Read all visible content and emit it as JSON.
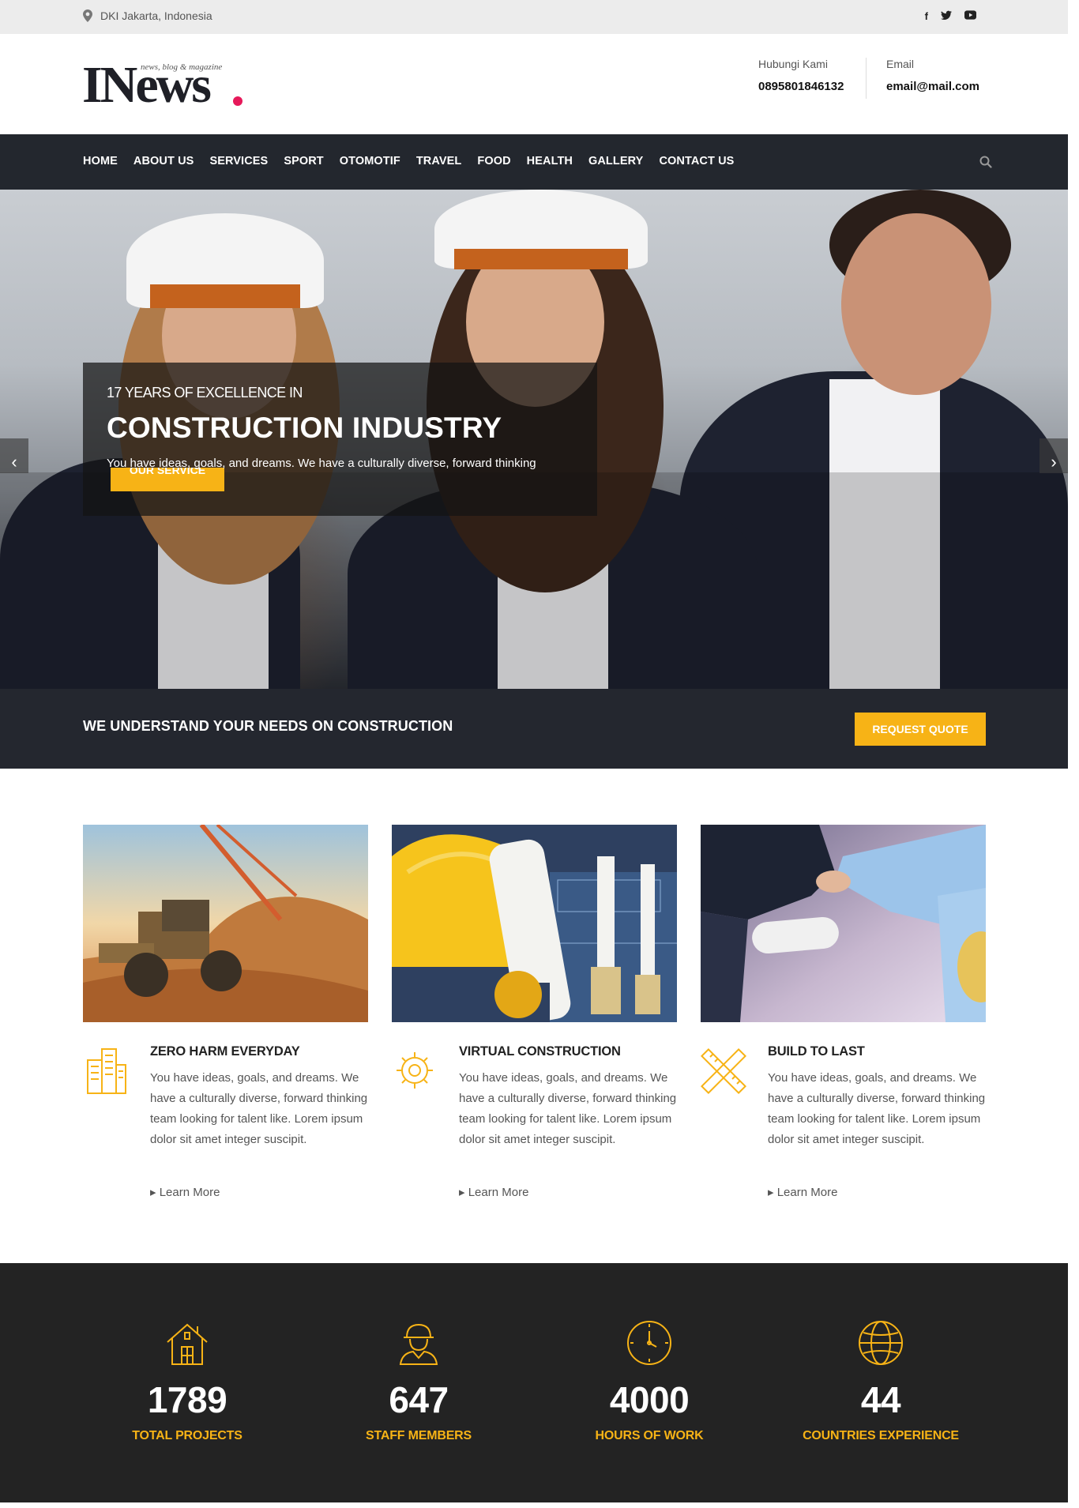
{
  "topbar": {
    "location": "DKI Jakarta, Indonesia",
    "social": [
      "f",
      "t",
      "y"
    ]
  },
  "header": {
    "logo_text": "INews",
    "logo_tagline": "news, blog & magazine",
    "contact_label": "Hubungi Kami",
    "contact_value": "0895801846132",
    "email_label": "Email",
    "email_value": "email@mail.com"
  },
  "nav": {
    "items": [
      "HOME",
      "ABOUT US",
      "SERVICES",
      "SPORT",
      "OTOMOTIF",
      "TRAVEL",
      "FOOD",
      "HEALTH",
      "GALLERY",
      "CONTACT US"
    ]
  },
  "hero": {
    "pretitle": "17 YEARS OF EXCELLENCE IN",
    "title": "CONSTRUCTION INDUSTRY",
    "description": "You have ideas, goals, and dreams. We have a culturally diverse, forward thinking",
    "button": "OUR SERVICE"
  },
  "cta": {
    "text": "WE UNDERSTAND YOUR NEEDS ON CONSTRUCTION",
    "button": "REQUEST QUOTE"
  },
  "features": [
    {
      "title": "ZERO HARM EVERYDAY",
      "body": "You have ideas, goals, and dreams. We have a culturally diverse, forward thinking team looking for talent like. Lorem ipsum dolor sit amet integer suscipit.",
      "link": "Learn More",
      "icon": "building-icon"
    },
    {
      "title": "VIRTUAL CONSTRUCTION",
      "body": "You have ideas, goals, and dreams. We have a culturally diverse, forward thinking team looking for talent like. Lorem ipsum dolor sit amet integer suscipit.",
      "link": "Learn More",
      "icon": "gear-tools-icon"
    },
    {
      "title": "BUILD TO LAST",
      "body": "You have ideas, goals, and dreams. We have a culturally diverse, forward thinking team looking for talent like. Lorem ipsum dolor sit amet integer suscipit.",
      "link": "Learn More",
      "icon": "ruler-pencil-icon"
    }
  ],
  "stats": [
    {
      "value": "1789",
      "label": "TOTAL PROJECTS",
      "icon": "house-icon"
    },
    {
      "value": "647",
      "label": "STAFF MEMBERS",
      "icon": "worker-icon"
    },
    {
      "value": "4000",
      "label": "HOURS OF WORK",
      "icon": "clock-icon"
    },
    {
      "value": "44",
      "label": "COUNTRIES EXPERIENCE",
      "icon": "globe-icon"
    }
  ],
  "colors": {
    "accent": "#f7b316",
    "dark": "#23272e",
    "logo_dot": "#e6195a"
  }
}
